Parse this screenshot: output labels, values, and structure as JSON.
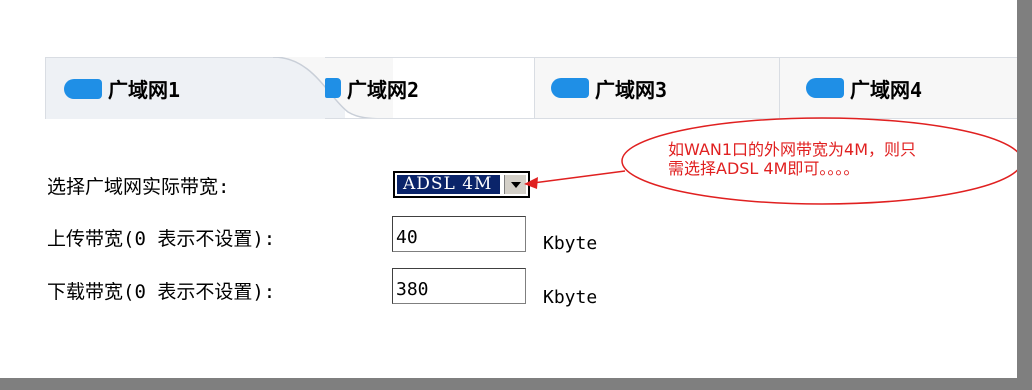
{
  "tabs": [
    {
      "label": "广域网1",
      "active": true
    },
    {
      "label": "广域网2",
      "active": false
    },
    {
      "label": "广域网3",
      "active": false
    },
    {
      "label": "广域网4",
      "active": false
    }
  ],
  "form": {
    "bandwidth_type_label": "选择广域网实际带宽:",
    "bandwidth_type_value": "ADSL 4M",
    "upload_label": "上传带宽(0 表示不设置):",
    "upload_value": "40",
    "upload_unit": "Kbyte",
    "download_label": "下载带宽(0 表示不设置):",
    "download_value": "380",
    "download_unit": "Kbyte"
  },
  "annotation": {
    "line1": "如WAN1口的外网带宽为4M，则只",
    "line2": "需选择ADSL 4M即可。。。。",
    "color": "#e02020"
  },
  "colors": {
    "tab_icon": "#1f8fe6",
    "select_highlight": "#0a246a",
    "border_gray": "#7f7f7f"
  }
}
